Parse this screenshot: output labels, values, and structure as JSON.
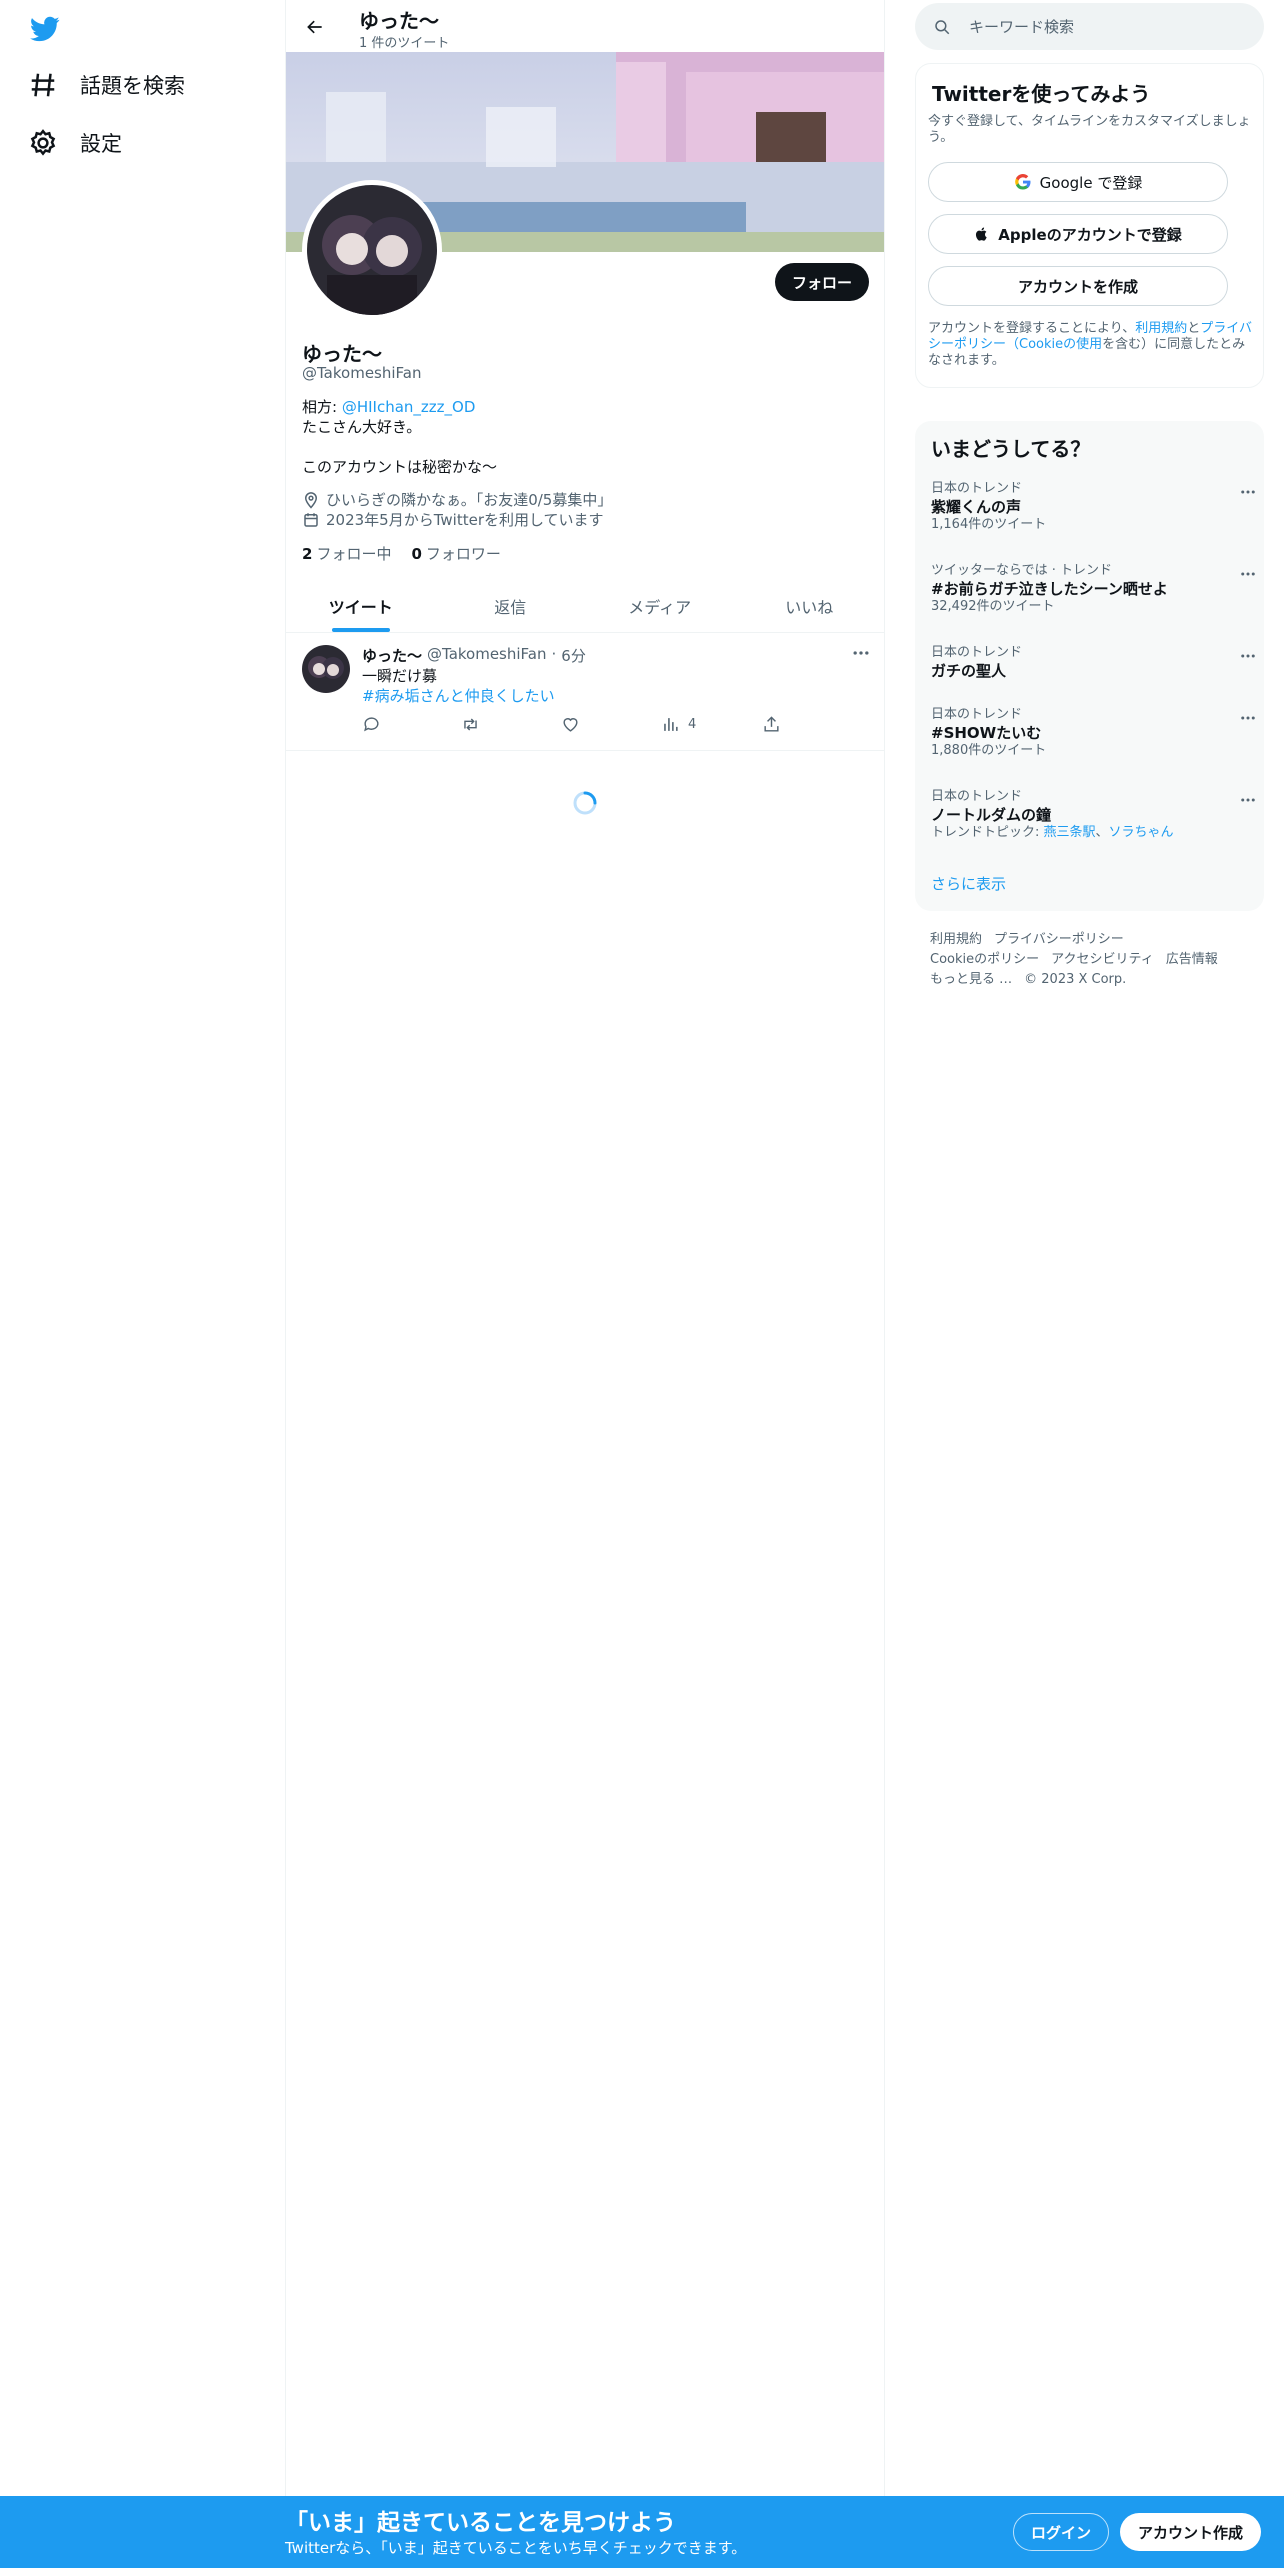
{
  "nav": {
    "explore_label": "話題を検索",
    "settings_label": "設定"
  },
  "profile": {
    "topbar_name": "ゆった～",
    "topbar_count": "1 件のツイート",
    "follow_label": "フォロー",
    "name": "ゆった～",
    "handle": "@TakomeshiFan",
    "bio_prefix": "相方: ",
    "bio_mention": "@HIIchan_zzz_OD",
    "bio_line2": "たこさん大好き。",
    "bio_line3": "このアカウントは秘密かな～",
    "location": "ひいらぎの隣かなぁ。「お友達0/5募集中」",
    "joined": "2023年5月からTwitterを利用しています",
    "following_count": "2",
    "following_label": "フォロー中",
    "followers_count": "0",
    "followers_label": "フォロワー"
  },
  "tabs": [
    "ツイート",
    "返信",
    "メディア",
    "いいね"
  ],
  "tweet": {
    "name": "ゆった～",
    "handle": "@TakomeshiFan",
    "dot": "·",
    "time": "6分",
    "text": "一瞬だけ募",
    "hashtag": "#病み垢さんと仲良くしたい",
    "views": "4"
  },
  "search": {
    "placeholder": "キーワード検索"
  },
  "signup": {
    "title": "Twitterを使ってみよう",
    "subtitle": "今すぐ登録して、タイムラインをカスタマイズしましょう。",
    "google_label": "Google で登録",
    "apple_label": "Appleのアカウントで登録",
    "create_label": "アカウントを作成",
    "legal_1": "アカウントを登録することにより、",
    "legal_terms": "利用規約",
    "legal_2": "と",
    "legal_privacy": "プライバシーポリシー（Cookieの使用",
    "legal_3": "を含む）に同意したとみなされます。"
  },
  "trends": {
    "title": "いまどうしてる？",
    "items": [
      {
        "context": "日本のトレンド",
        "name": "紫耀くんの声",
        "count": "1,164件のツイート"
      },
      {
        "context": "ツイッターならでは · トレンド",
        "name": "#お前らガチ泣きしたシーン晒せよ",
        "count": "32,492件のツイート"
      },
      {
        "context": "日本のトレンド",
        "name": "ガチの聖人",
        "count": ""
      },
      {
        "context": "日本のトレンド",
        "name": "#SHOWたいむ",
        "count": "1,880件のツイート"
      },
      {
        "context": "日本のトレンド",
        "name": "ノートルダムの鐘",
        "count_prefix": "トレンドトピック: ",
        "topic1": "燕三条駅",
        "sep": "、",
        "topic2": "ソラちゃん"
      }
    ],
    "show_more": "さらに表示"
  },
  "footer": {
    "links": [
      "利用規約",
      "プライバシーポリシー",
      "Cookieのポリシー",
      "アクセシビリティ",
      "広告情報",
      "もっと見る …",
      "© 2023 X Corp."
    ]
  },
  "bottom": {
    "title": "「いま」起きていることを見つけよう",
    "subtitle": "Twitterなら、「いま」起きていることをいち早くチェックできます。",
    "login": "ログイン",
    "create": "アカウント作成"
  },
  "colors": {
    "accent": "#1d9bf0",
    "text": "#0f1419",
    "muted": "#536471",
    "border": "#eff3f4"
  }
}
